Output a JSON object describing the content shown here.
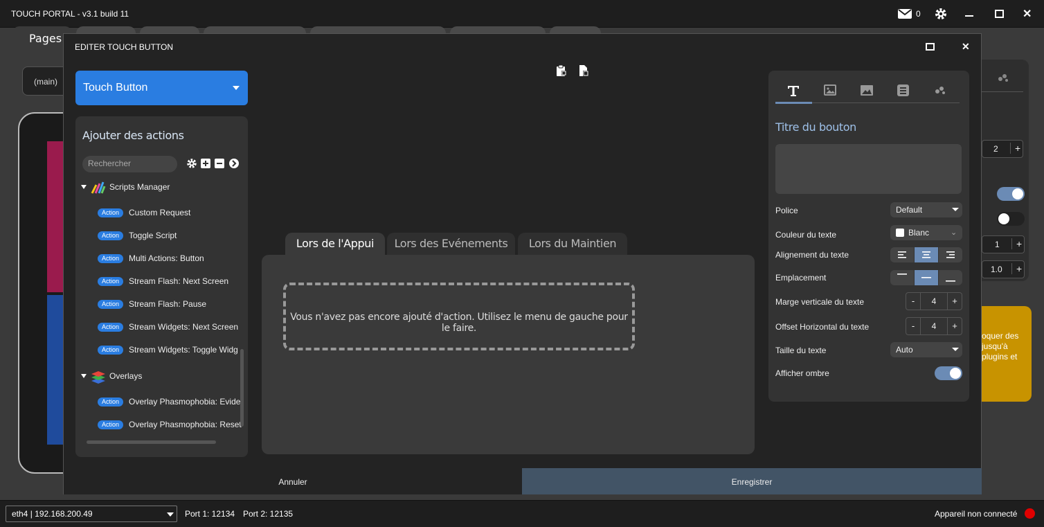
{
  "window": {
    "title": "TOUCH PORTAL - v3.1 build 11",
    "mail_count": "0"
  },
  "background": {
    "pages_tab": "Pages",
    "page_select": "(main)",
    "stepper_a": "2",
    "stepper_b": "1",
    "stepper_c": "1.0",
    "yellow_text": "oquer des jusqu'à plugins et"
  },
  "status": {
    "network": "eth4 | 192.168.200.49",
    "port1": "Port 1: 12134",
    "port2": "Port 2: 12135",
    "device_status": "Appareil non connecté",
    "device_status_color": "#e00000"
  },
  "modal": {
    "title": "EDITER TOUCH BUTTON",
    "type_select": "Touch Button",
    "actions_title": "Ajouter des actions",
    "search_placeholder": "Rechercher",
    "groups": [
      {
        "name": "Scripts Manager",
        "items": [
          "Custom Request",
          "Toggle Script",
          "Multi Actions: Button",
          "Stream Flash: Next Screen",
          "Stream Flash: Pause",
          "Stream Widgets: Next Screen",
          "Stream Widgets: Toggle Widg"
        ]
      },
      {
        "name": "Overlays",
        "items": [
          "Overlay Phasmophobia: Evide",
          "Overlay Phasmophobia: Reset"
        ]
      }
    ],
    "action_badge": "Action",
    "tabs": [
      "Lors de l'Appui",
      "Lors des Evénements",
      "Lors du Maintien"
    ],
    "empty_message": "Vous n'avez pas encore ajouté d'action. Utilisez le menu de gauche pour le faire.",
    "props": {
      "title_label": "Titre du bouton",
      "font_label": "Police",
      "font_value": "Default",
      "color_label": "Couleur du texte",
      "color_value": "Blanc",
      "align_label": "Alignement du texte",
      "position_label": "Emplacement",
      "vmargin_label": "Marge verticale du texte",
      "vmargin_value": "4",
      "hoffset_label": "Offset Horizontal du texte",
      "hoffset_value": "4",
      "size_label": "Taille du texte",
      "size_value": "Auto",
      "shadow_label": "Afficher ombre"
    },
    "cancel": "Annuler",
    "save": "Enregistrer"
  }
}
